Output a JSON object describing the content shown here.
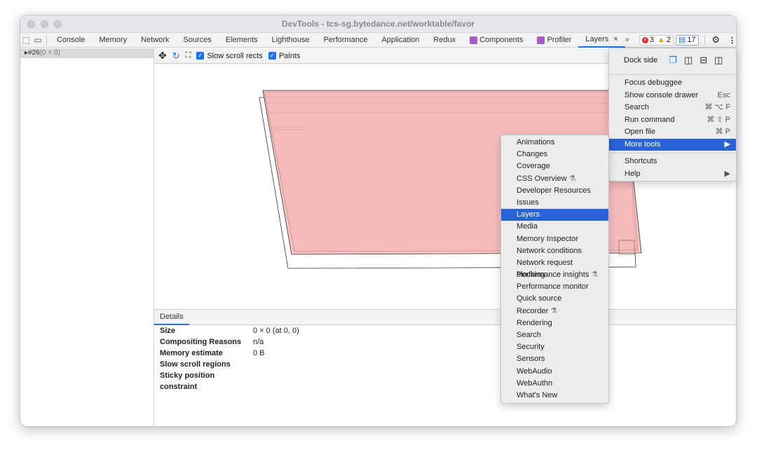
{
  "window": {
    "title": "DevTools - tcs-sg.bytedance.net/worktable/favor"
  },
  "tabs": [
    {
      "label": "Console"
    },
    {
      "label": "Memory"
    },
    {
      "label": "Network"
    },
    {
      "label": "Sources"
    },
    {
      "label": "Elements"
    },
    {
      "label": "Lighthouse"
    },
    {
      "label": "Performance"
    },
    {
      "label": "Application"
    },
    {
      "label": "Redux"
    },
    {
      "label": "Components",
      "icon": "react-icon"
    },
    {
      "label": "Profiler",
      "icon": "react-icon"
    },
    {
      "label": "Layers",
      "active": true
    }
  ],
  "badges": {
    "errors": "3",
    "warnings": "2",
    "messages": "17"
  },
  "layer_tree": {
    "item": "#26",
    "size": "(0 × 0)"
  },
  "toolbar": {
    "slow_scroll": "Slow scroll rects",
    "paints": "Paints"
  },
  "details": {
    "tab": "Details",
    "rows": [
      {
        "label": "Size",
        "value": "0 × 0 (at 0, 0)"
      },
      {
        "label": "Compositing Reasons",
        "value": "n/a"
      },
      {
        "label": "Memory estimate",
        "value": "0 B"
      },
      {
        "label": "Slow scroll regions",
        "value": ""
      },
      {
        "label": "Sticky position constraint",
        "value": ""
      }
    ]
  },
  "main_menu": {
    "dock_side": "Dock side",
    "items": [
      {
        "label": "Focus debuggee",
        "shortcut": ""
      },
      {
        "label": "Show console drawer",
        "shortcut": "Esc"
      },
      {
        "label": "Search",
        "shortcut": "⌘ ⌥ F"
      },
      {
        "label": "Run command",
        "shortcut": "⌘ ⇧ P"
      },
      {
        "label": "Open file",
        "shortcut": "⌘ P"
      },
      {
        "label": "More tools",
        "shortcut": "▶"
      }
    ],
    "items2": [
      {
        "label": "Shortcuts",
        "shortcut": ""
      },
      {
        "label": "Help",
        "shortcut": "▶"
      }
    ]
  },
  "more_tools": [
    "Animations",
    "Changes",
    "Coverage",
    "CSS Overview",
    "Developer Resources",
    "Issues",
    "Layers",
    "Media",
    "Memory Inspector",
    "Network conditions",
    "Network request blocking",
    "Performance insights",
    "Performance monitor",
    "Quick source",
    "Recorder",
    "Rendering",
    "Search",
    "Security",
    "Sensors",
    "WebAudio",
    "WebAuthn",
    "What's New"
  ],
  "more_tools_selected": "Layers",
  "more_tools_experimental": [
    "CSS Overview",
    "Performance insights",
    "Recorder"
  ],
  "colors": {
    "accent": "#1a73e8",
    "menu_highlight": "#2962d9",
    "layer_fill": "#f4b4b4"
  }
}
